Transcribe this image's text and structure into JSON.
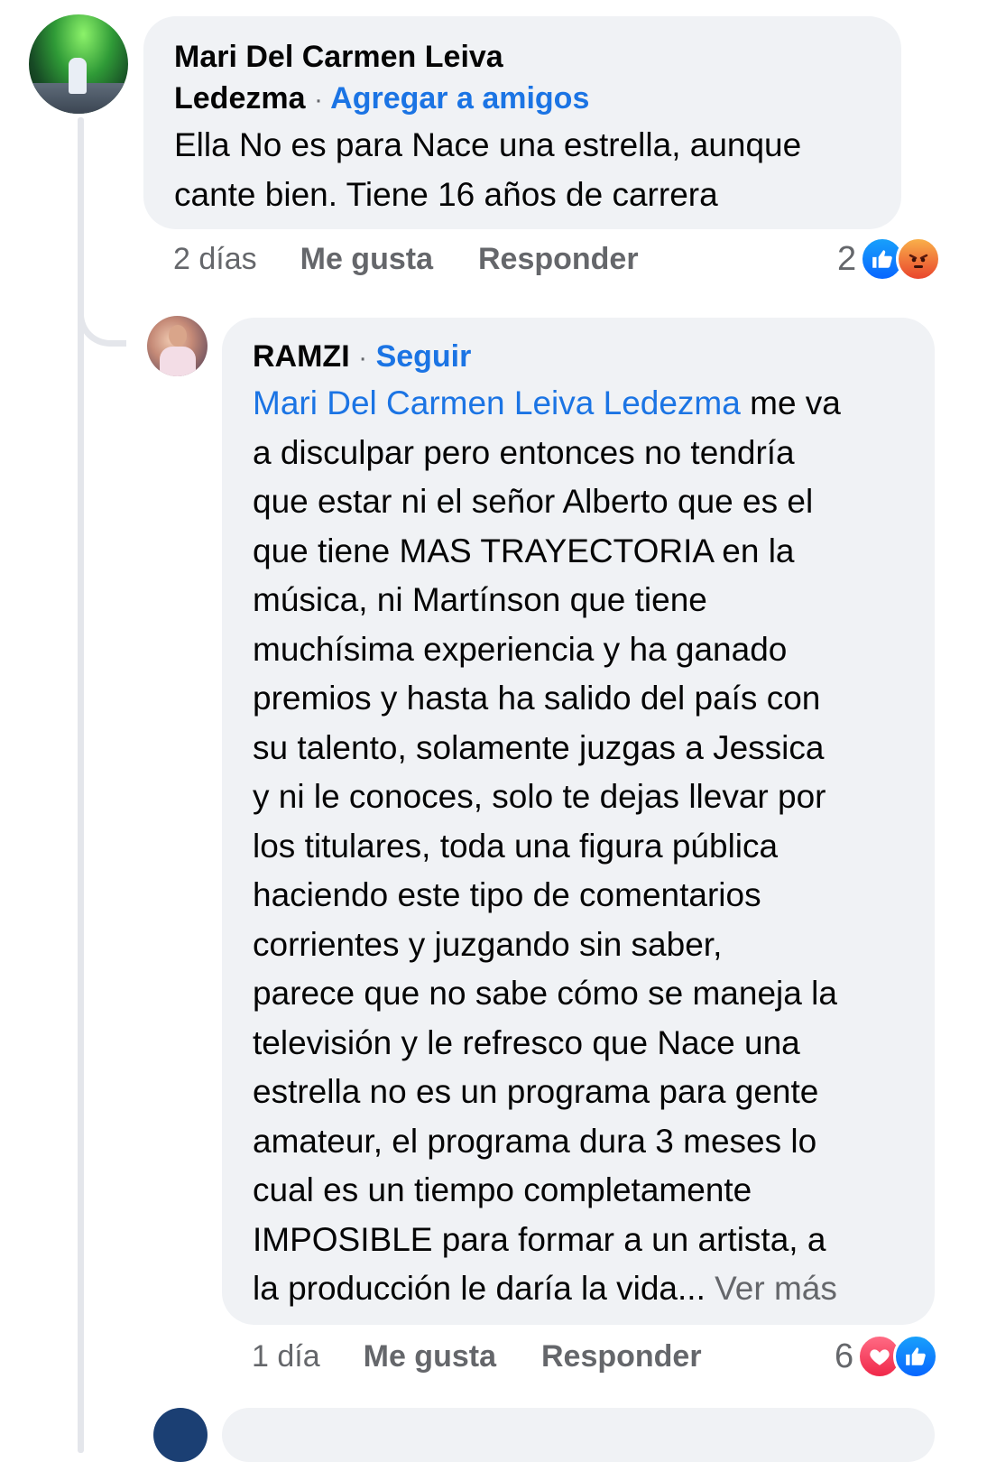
{
  "comments": [
    {
      "author_line1": "Mari Del Carmen Leiva",
      "author_line2": "Ledezma",
      "separator": "·",
      "action": "Agregar a amigos",
      "text_line1": "Ella No es para Nace una estrella, aunque",
      "text_line2": "cante bien. Tiene 16 años de carrera",
      "time": "2 días",
      "like_label": "Me gusta",
      "reply_label": "Responder",
      "reaction_count": "2",
      "reaction_icons": [
        "like-icon",
        "angry-icon"
      ]
    },
    {
      "author": "RAMZI",
      "separator": "·",
      "action": "Seguir",
      "mention": "Mari Del Carmen Leiva Ledezma",
      "lines": [
        " me va",
        "a disculpar pero entonces no tendría",
        "que estar ni el señor Alberto que es el",
        "que tiene MAS TRAYECTORIA en la",
        "música, ni Martínson que tiene",
        "muchísima experiencia y ha ganado",
        "premios y hasta ha salido del país con",
        "su talento, solamente juzgas a Jessica",
        "y ni le conoces, solo te dejas llevar por",
        "los titulares, toda una figura pública",
        "haciendo este tipo de comentarios",
        "corrientes y juzgando sin saber,",
        "parece que no sabe cómo se maneja la",
        "televisión y le refresco que Nace una",
        "estrella no es un programa para gente",
        "amateur, el programa dura 3 meses lo",
        "cual es un tiempo completamente",
        "IMPOSIBLE para formar a un artista, a",
        "la producción le daría la vida..."
      ],
      "see_more": "Ver más",
      "time": "1 día",
      "like_label": "Me gusta",
      "reply_label": "Responder",
      "reaction_count": "6",
      "reaction_icons": [
        "love-icon",
        "like-icon"
      ]
    }
  ],
  "colors": {
    "link": "#1b74e4",
    "bubble": "#f0f2f5",
    "meta": "#65676b"
  }
}
